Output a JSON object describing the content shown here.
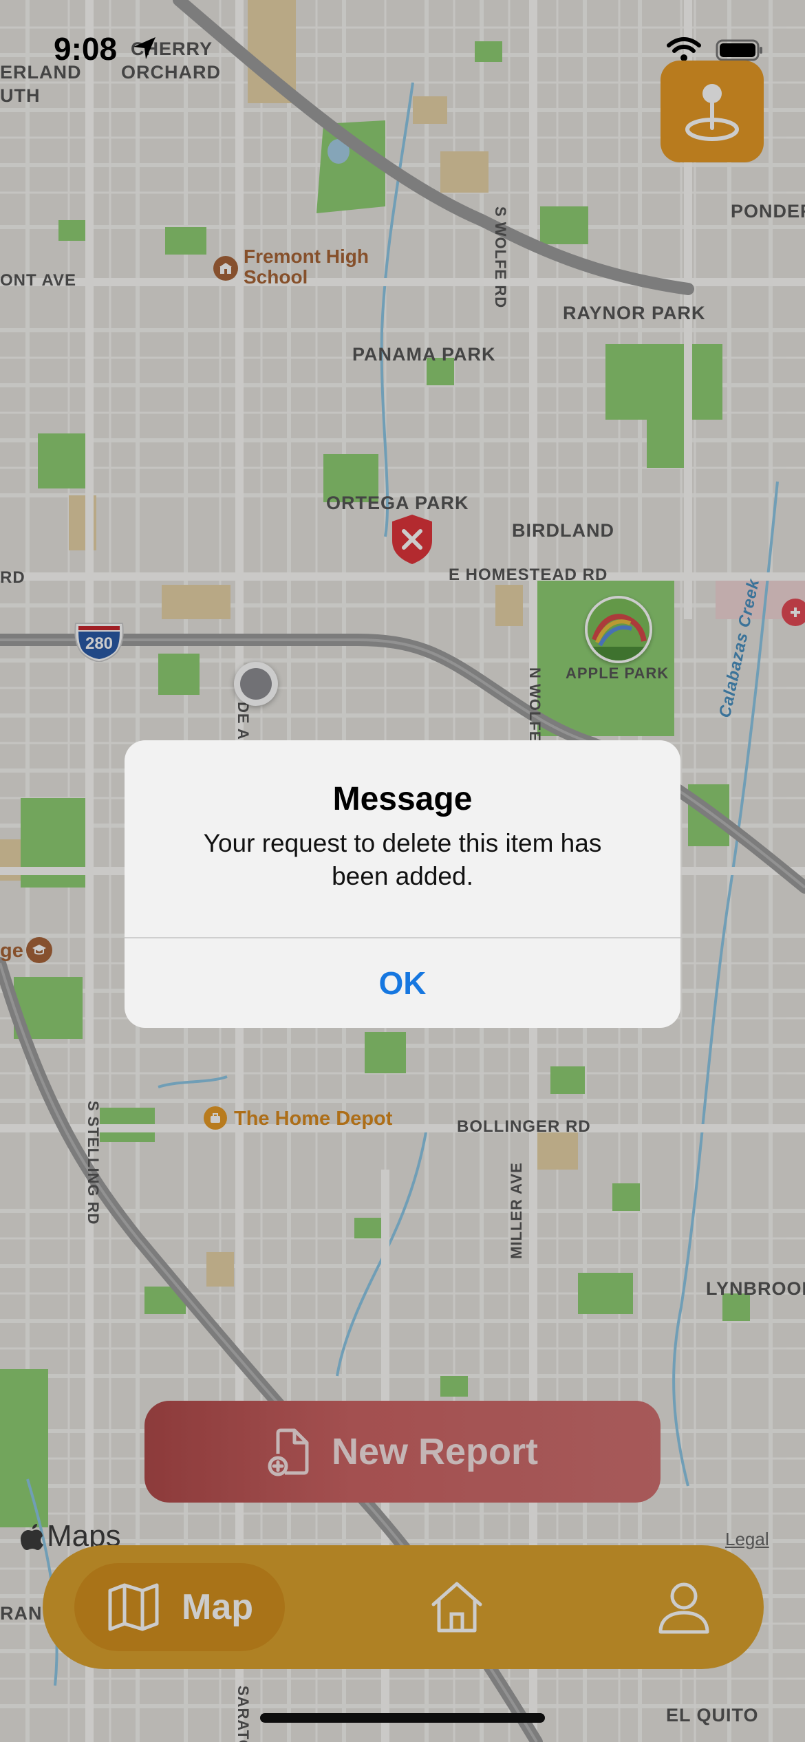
{
  "status_bar": {
    "time": "9:08"
  },
  "map": {
    "labels": [
      {
        "text": "CHERRY"
      },
      {
        "text": "ORCHARD"
      },
      {
        "text": "ERLAND"
      },
      {
        "text": "UTH"
      },
      {
        "text": "PONDER"
      },
      {
        "text": "ONT AVE"
      },
      {
        "text": "RAYNOR PARK"
      },
      {
        "text": "PANAMA PARK"
      },
      {
        "text": "ORTEGA PARK"
      },
      {
        "text": "BIRDLAND"
      },
      {
        "text": "E HOMESTEAD RD"
      },
      {
        "text": "RD"
      },
      {
        "text": "APPLE PARK"
      },
      {
        "text": "S WOLFE RD"
      },
      {
        "text": "N WOLFE"
      },
      {
        "text": "Calabazas Creek"
      },
      {
        "text": "BOLLINGER RD"
      },
      {
        "text": "MILLER AVE"
      },
      {
        "text": "S STELLING RD"
      },
      {
        "text": "LYNBROOK"
      },
      {
        "text": "EL QUITO"
      },
      {
        "text": "RAN"
      },
      {
        "text": "ge"
      },
      {
        "text": "SARATO"
      },
      {
        "text": "DE A"
      }
    ],
    "pois": {
      "school": "Fremont High School",
      "store": "The Home Depot"
    },
    "highway_shield": "280"
  },
  "alert": {
    "title": "Message",
    "message": "Your request to delete this item has been added.",
    "ok_label": "OK"
  },
  "new_report": {
    "label": "New Report"
  },
  "attribution": {
    "maps": "Maps",
    "legal": "Legal"
  },
  "tab_bar": {
    "tabs": [
      {
        "label": "Map",
        "icon": "map-icon",
        "active": true
      },
      {
        "label": "",
        "icon": "home-icon",
        "active": false
      },
      {
        "label": "",
        "icon": "person-icon",
        "active": false
      }
    ]
  },
  "colors": {
    "accent_orange": "#dba22e",
    "report_red": "#cc6464",
    "alert_button_blue": "#1677e0",
    "map_background": "#e6e4df",
    "park_green": "#8fcf74"
  }
}
